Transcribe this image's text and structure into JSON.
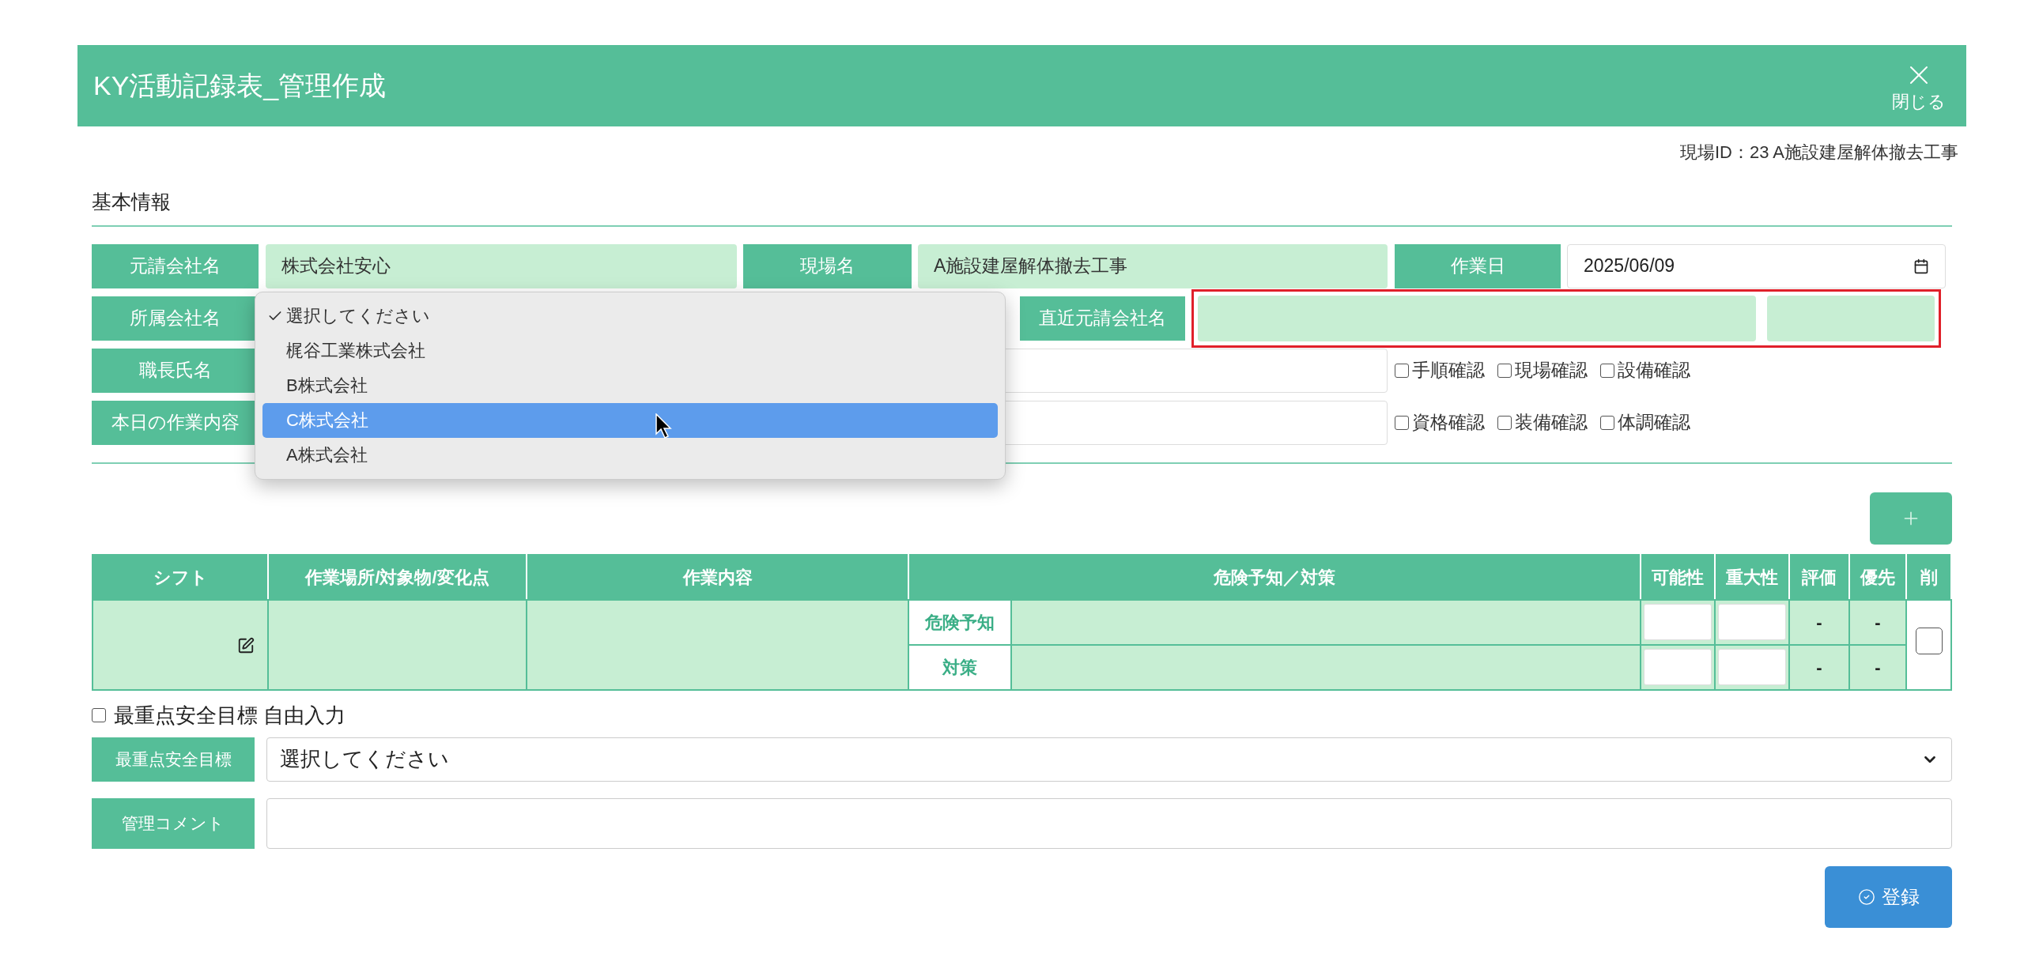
{
  "window": {
    "title": "KY活動記録表_管理作成",
    "close_label": "閉じる"
  },
  "site_id": "現場ID：23 A施設建屋解体撤去工事",
  "section_title": "基本情報",
  "prime_contractor": {
    "label": "元請会社名",
    "value": "株式会社安心"
  },
  "site_name": {
    "label": "現場名",
    "value": "A施設建屋解体撤去工事"
  },
  "work_date": {
    "label": "作業日",
    "value": "2025/06/09"
  },
  "affiliated_company": {
    "label": "所属会社名",
    "expanded": true,
    "options": [
      {
        "label": "選択してください",
        "checked": true,
        "selected": false
      },
      {
        "label": "梶谷工業株式会社",
        "checked": false,
        "selected": false
      },
      {
        "label": "B株式会社",
        "checked": false,
        "selected": false
      },
      {
        "label": "C株式会社",
        "checked": false,
        "selected": true
      },
      {
        "label": "A株式会社",
        "checked": false,
        "selected": false
      }
    ]
  },
  "recent_prime": {
    "label": "直近元請会社名",
    "highlighted": true
  },
  "foreman": {
    "label": "職長氏名"
  },
  "todays_work": {
    "label": "本日の作業内容"
  },
  "checks": [
    [
      {
        "label": "手順確認",
        "checked": false
      },
      {
        "label": "現場確認",
        "checked": false
      },
      {
        "label": "設備確認",
        "checked": false
      }
    ],
    [
      {
        "label": "資格確認",
        "checked": false
      },
      {
        "label": "装備確認",
        "checked": false
      },
      {
        "label": "体調確認",
        "checked": false
      }
    ]
  ],
  "table": {
    "columns": [
      "シフト",
      "作業場所/対象物/変化点",
      "作業内容",
      "危険予知／対策",
      "可能性",
      "重大性",
      "評価",
      "優先",
      "削"
    ],
    "rows": [
      {
        "delete_checked": false,
        "sub_rows": [
          {
            "label": "危険予知",
            "rating": "-",
            "priority": "-"
          },
          {
            "label": "対策",
            "rating": "-",
            "priority": "-"
          }
        ]
      }
    ]
  },
  "free_input": {
    "label": "最重点安全目標 自由入力",
    "checked": false
  },
  "safety_goal": {
    "label": "最重点安全目標",
    "value": "選択してください"
  },
  "comment": {
    "label": "管理コメント"
  },
  "submit": "登録"
}
